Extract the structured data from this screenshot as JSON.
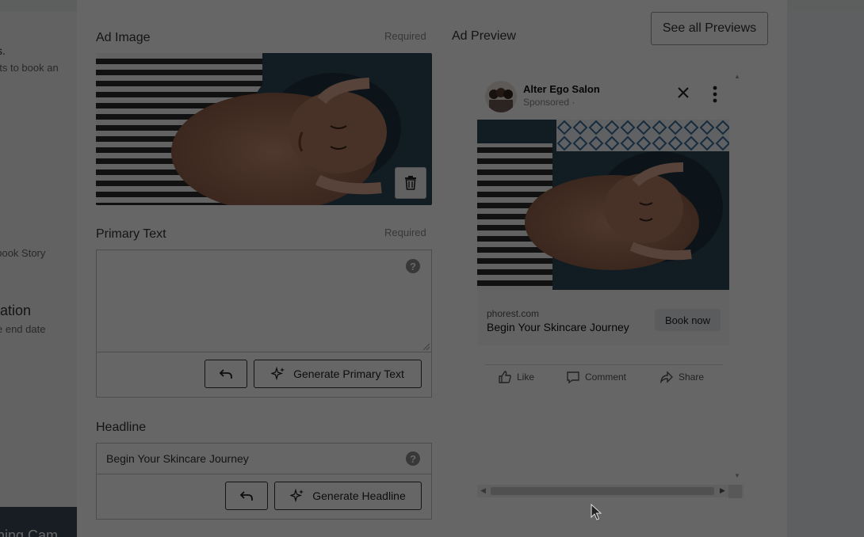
{
  "background": {
    "frag1": "s.",
    "frag2": "nts to book an",
    "frag3": "ebook Story",
    "frag4": "ration",
    "frag5": "e end date",
    "frag6": "ning Cam"
  },
  "ad_image": {
    "label": "Ad Image",
    "required": "Required"
  },
  "primary_text": {
    "label": "Primary Text",
    "required": "Required",
    "value": "",
    "generate_label": "Generate Primary Text"
  },
  "headline": {
    "label": "Headline",
    "value": "Begin Your Skincare Journey",
    "generate_label": "Generate Headline"
  },
  "preview": {
    "title": "Ad Preview",
    "see_all_label": "See all Previews",
    "page_name": "Alter Ego Salon",
    "sponsored": "Sponsored ·",
    "domain": "phorest.com",
    "headline": "Begin Your Skincare Journey",
    "cta": "Book now",
    "actions": {
      "like": "Like",
      "comment": "Comment",
      "share": "Share"
    }
  },
  "colors": {
    "overlay": "#000000",
    "modal_bg": "#ffffff"
  },
  "icons": [
    "trash-icon",
    "help-icon",
    "undo-icon",
    "sparkle-icon",
    "close-icon",
    "more-vertical-icon",
    "like-icon",
    "comment-icon",
    "share-icon",
    "cursor-icon"
  ]
}
